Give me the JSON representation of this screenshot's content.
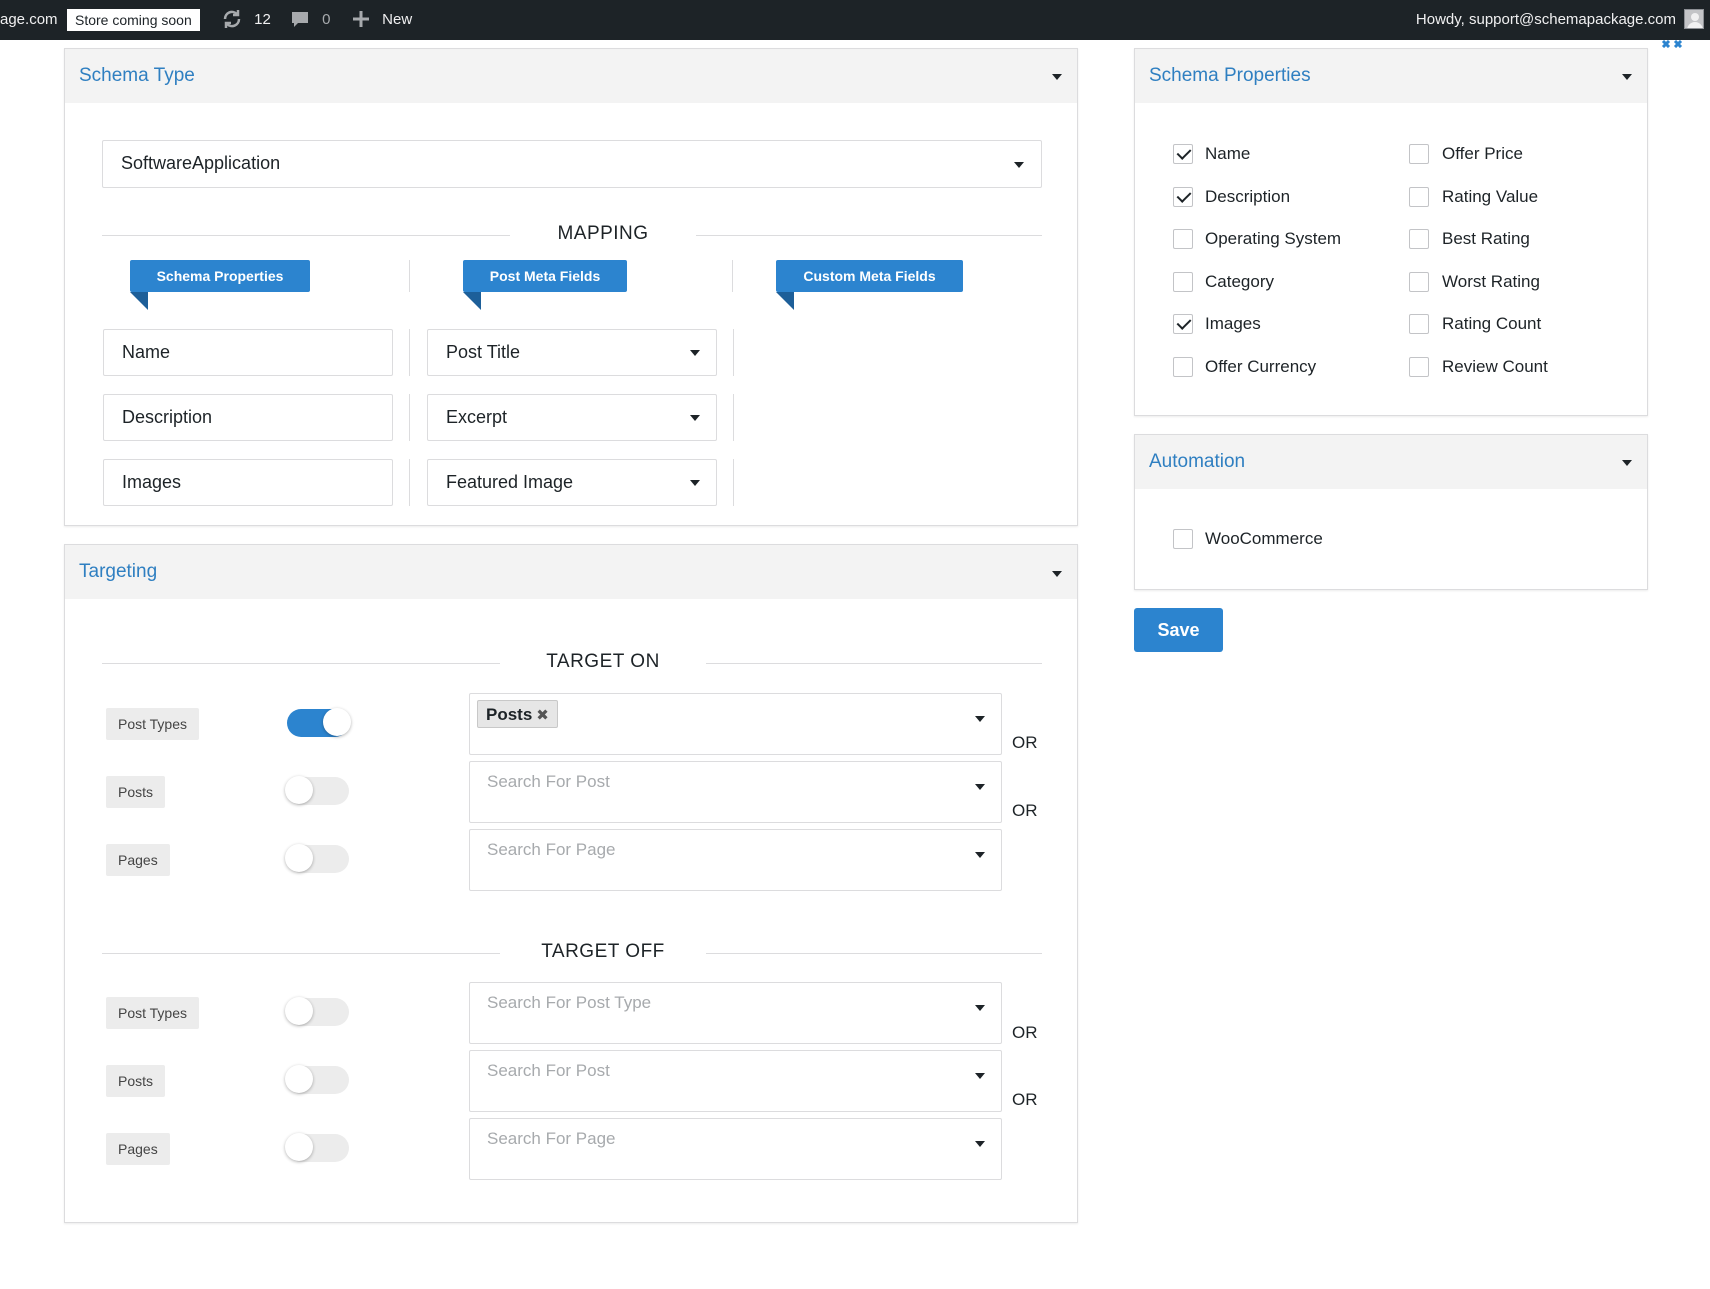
{
  "adminbar": {
    "site_fragment": "age.com",
    "store_badge": "Store coming soon",
    "updates_count": "12",
    "comments_count": "0",
    "new_label": "New",
    "howdy": "Howdy, support@schemapackage.com"
  },
  "schema_type": {
    "title": "Schema Type",
    "selected": "SoftwareApplication",
    "mapping_label": "MAPPING",
    "columns": {
      "schema_properties": "Schema Properties",
      "post_meta_fields": "Post Meta Fields",
      "custom_meta_fields": "Custom Meta Fields"
    },
    "rows": [
      {
        "property": "Name",
        "meta": "Post Title"
      },
      {
        "property": "Description",
        "meta": "Excerpt"
      },
      {
        "property": "Images",
        "meta": "Featured Image"
      }
    ]
  },
  "targeting": {
    "title": "Targeting",
    "target_on_label": "TARGET ON",
    "target_off_label": "TARGET OFF",
    "or_label": "OR",
    "target_on": [
      {
        "label": "Posts",
        "enabled": true,
        "selected_tag": "Posts"
      },
      {
        "label": "Posts",
        "enabled": false,
        "placeholder": "Search For Post"
      },
      {
        "label": "Pages",
        "enabled": false,
        "placeholder": "Search For Page"
      }
    ],
    "target_on_first_label": "Post Types",
    "target_off": [
      {
        "label": "Post Types",
        "enabled": false,
        "placeholder": "Search For Post Type"
      },
      {
        "label": "Posts",
        "enabled": false,
        "placeholder": "Search For Post"
      },
      {
        "label": "Pages",
        "enabled": false,
        "placeholder": "Search For Page"
      }
    ]
  },
  "schema_properties": {
    "title": "Schema Properties",
    "left": [
      {
        "label": "Name",
        "checked": true
      },
      {
        "label": "Description",
        "checked": true
      },
      {
        "label": "Operating System",
        "checked": false
      },
      {
        "label": "Category",
        "checked": false
      },
      {
        "label": "Images",
        "checked": true
      },
      {
        "label": "Offer Currency",
        "checked": false
      }
    ],
    "right": [
      {
        "label": "Offer Price",
        "checked": false
      },
      {
        "label": "Rating Value",
        "checked": false
      },
      {
        "label": "Best Rating",
        "checked": false
      },
      {
        "label": "Worst Rating",
        "checked": false
      },
      {
        "label": "Rating Count",
        "checked": false
      },
      {
        "label": "Review Count",
        "checked": false
      }
    ]
  },
  "automation": {
    "title": "Automation",
    "woocommerce": {
      "label": "WooCommerce",
      "checked": false
    }
  },
  "save_label": "Save"
}
